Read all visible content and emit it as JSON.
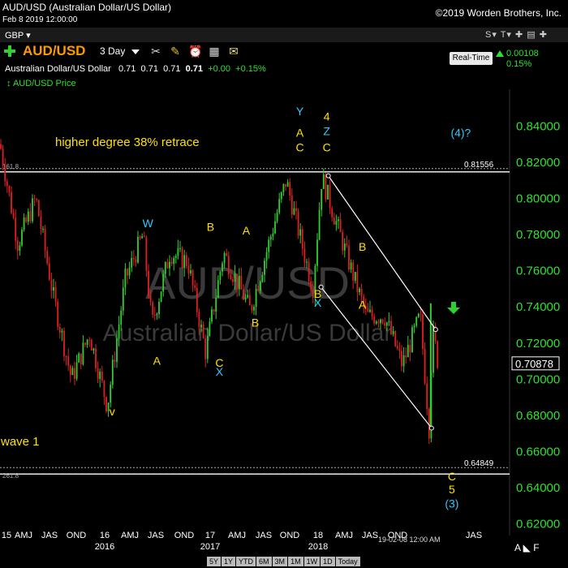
{
  "window": {
    "title": "AUD/USD (Australian Dollar/US Dollar)",
    "date": "Feb 8 2019 12:00:00",
    "copyright": "©2019 Worden Brothers, Inc."
  },
  "toolbar": {
    "currency": "GBP ▾",
    "symbol": "AUD/USD",
    "interval": "3 Day",
    "realtime_label": "Real-Time",
    "change_abs": "0.00108",
    "change_pct": "0.15%",
    "right_icons": "S▾ T▾ ✚ ▤ ✚"
  },
  "quote": {
    "name": "Australian Dollar/US Dollar",
    "open": "0.71",
    "high": "0.71",
    "low": "0.71",
    "close": "0.71",
    "change": "+0.00",
    "change_pct": "+0.15%"
  },
  "legend_label": "↕ AUD/USD Price",
  "footer": {
    "corner": "A ◣ F",
    "periods": [
      "5Y",
      "1Y",
      "YTD",
      "6M",
      "3M",
      "1M",
      "1W",
      "1D",
      "Today"
    ]
  },
  "colors": {
    "up": "#30d030",
    "down": "#e02020",
    "axis": "#30e030",
    "wave_yellow": "#ffe000",
    "wave_cyan": "#30c8ff"
  },
  "chart_data": {
    "type": "candlestick",
    "watermark": "AUD/USD",
    "watermark_sub": "Australian Dollar/US Dollar",
    "ylim": [
      0.6,
      0.85
    ],
    "yticks": [
      "0.84000",
      "0.82000",
      "0.80000",
      "0.78000",
      "0.76000",
      "0.74000",
      "0.72000",
      "0.70000",
      "0.68000",
      "0.66000",
      "0.64000",
      "0.62000"
    ],
    "xticks": [
      "15",
      "AMJ",
      "JAS",
      "OND",
      "16",
      "AMJ",
      "JAS",
      "OND",
      "17",
      "AMJ",
      "JAS",
      "OND",
      "18",
      "AMJ",
      "JAS",
      "OND",
      "19-02-08 12:00 AM",
      "JAS"
    ],
    "year_labels": [
      "2016",
      "2017",
      "2018"
    ],
    "last_price": "0.70878",
    "price_path": [
      [
        "2015-01",
        0.83
      ],
      [
        "2015-03",
        0.775
      ],
      [
        "2015-05",
        0.8
      ],
      [
        "2015-07",
        0.745
      ],
      [
        "2015-09",
        0.7
      ],
      [
        "2015-11",
        0.725
      ],
      [
        "2016-01",
        0.685
      ],
      [
        "2016-03",
        0.755
      ],
      [
        "2016-05",
        0.78
      ],
      [
        "2016-06",
        0.73
      ],
      [
        "2016-08",
        0.77
      ],
      [
        "2016-10",
        0.765
      ],
      [
        "2016-12",
        0.715
      ],
      [
        "2017-02",
        0.77
      ],
      [
        "2017-05",
        0.738
      ],
      [
        "2017-09",
        0.81
      ],
      [
        "2017-12",
        0.75
      ],
      [
        "2018-01",
        0.812
      ],
      [
        "2018-04",
        0.765
      ],
      [
        "2018-06",
        0.735
      ],
      [
        "2018-08",
        0.735
      ],
      [
        "2018-10",
        0.708
      ],
      [
        "2018-12",
        0.735
      ],
      [
        "2019-01",
        0.673
      ],
      [
        "2019-01",
        0.728
      ],
      [
        "2019-02",
        0.709
      ]
    ],
    "horizontal_levels": [
      {
        "price": 0.81556,
        "label": "0.81556",
        "note": "higher degree 38% retrace",
        "left_label": "161.8"
      },
      {
        "price": 0.64849,
        "label": "0.64849",
        "note": "wave 1",
        "left_label": "261.8"
      }
    ],
    "channel": {
      "upper": [
        [
          "2018-01",
          0.8125
        ],
        [
          "2019-01",
          0.7275
        ]
      ],
      "lower": [
        [
          "2017-12",
          0.751
        ],
        [
          "2019-01",
          0.673
        ]
      ]
    },
    "wave_labels": [
      {
        "text": "W",
        "color": "cyan",
        "at": [
          "2016-05",
          0.784
        ]
      },
      {
        "text": "v",
        "color": "yellow",
        "at": [
          "2016-01",
          0.68
        ]
      },
      {
        "text": "A",
        "color": "yellow",
        "at": [
          "2016-06",
          0.708
        ]
      },
      {
        "text": "B",
        "color": "yellow",
        "at": [
          "2016-12",
          0.782
        ]
      },
      {
        "text": "C",
        "color": "yellow",
        "at": [
          "2017-01",
          0.707
        ]
      },
      {
        "text": "X",
        "color": "cyan",
        "at": [
          "2017-01",
          0.702
        ]
      },
      {
        "text": "A",
        "color": "yellow",
        "at": [
          "2017-04",
          0.78
        ]
      },
      {
        "text": "B",
        "color": "yellow",
        "at": [
          "2017-05",
          0.729
        ]
      },
      {
        "text": "Y",
        "color": "cyan",
        "at": [
          "2017-10",
          0.846
        ]
      },
      {
        "text": "A",
        "color": "yellow",
        "at": [
          "2017-10",
          0.834
        ]
      },
      {
        "text": "C",
        "color": "yellow",
        "at": [
          "2017-10",
          0.826
        ]
      },
      {
        "text": "4",
        "color": "yellow",
        "at": [
          "2018-01",
          0.843
        ]
      },
      {
        "text": "Z",
        "color": "cyan",
        "at": [
          "2018-01",
          0.835
        ]
      },
      {
        "text": "C",
        "color": "yellow",
        "at": [
          "2018-01",
          0.826
        ]
      },
      {
        "text": "B",
        "color": "yellow",
        "at": [
          "2017-12",
          0.745
        ]
      },
      {
        "text": "X",
        "color": "cyan",
        "at": [
          "2017-12",
          0.74
        ]
      },
      {
        "text": "B",
        "color": "yellow",
        "at": [
          "2018-05",
          0.771
        ]
      },
      {
        "text": "A",
        "color": "yellow",
        "at": [
          "2018-05",
          0.739
        ]
      },
      {
        "text": "(4)?",
        "color": "cyan",
        "at": [
          "2019-04",
          0.834
        ]
      },
      {
        "text": "C",
        "color": "yellow",
        "at": [
          "2019-03",
          0.644
        ]
      },
      {
        "text": "5",
        "color": "yellow",
        "at": [
          "2019-03",
          0.637
        ]
      },
      {
        "text": "(3)",
        "color": "cyan",
        "at": [
          "2019-03",
          0.629
        ]
      }
    ]
  }
}
